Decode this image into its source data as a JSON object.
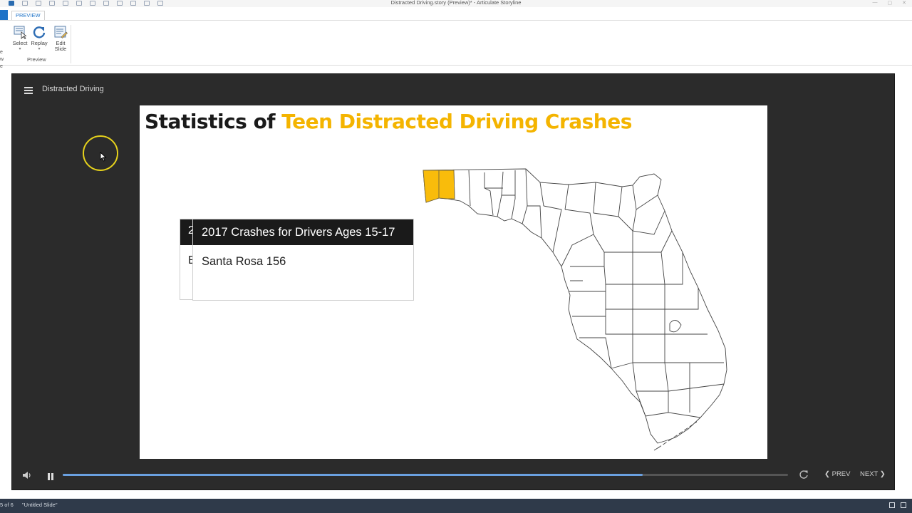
{
  "app": {
    "window_title": "Distracted Driving.story (Preview)* -  Articulate Storyline"
  },
  "ribbon": {
    "tab": "PREVIEW",
    "left_stub": [
      "e",
      "w",
      "e"
    ],
    "buttons": [
      {
        "label": "Select",
        "icon": "select-icon"
      },
      {
        "label": "Replay",
        "icon": "replay-icon"
      },
      {
        "label_line1": "Edit",
        "label_line2": "Slide",
        "icon": "edit-slide-icon"
      }
    ],
    "group_label": "Preview",
    "device_views": [
      "desktop",
      "tablet-landscape",
      "tablet-portrait",
      "phone-landscape",
      "phone-portrait"
    ],
    "active_device": "desktop"
  },
  "player": {
    "course_title": "Distracted Driving",
    "slide": {
      "title_plain": "Statistics of ",
      "title_accent": "Teen Distracted Driving Crashes",
      "accent_color": "#f4b400",
      "popup_back": {
        "heading_fragment": "2",
        "body_fragment": "E"
      },
      "popup": {
        "heading": "2017 Crashes for Drivers Ages 15-17",
        "body": "Santa Rosa 156"
      },
      "map": {
        "region": "Florida counties",
        "highlighted": [
          "Escambia",
          "Santa Rosa"
        ],
        "highlight_color": "#f9bc0b"
      }
    },
    "controls": {
      "prev": "PREV",
      "next": "NEXT",
      "progress": 0.8
    }
  },
  "statusbar": {
    "slide_info": "5 of 6",
    "slide_name": "\"Untitled Slide\""
  }
}
